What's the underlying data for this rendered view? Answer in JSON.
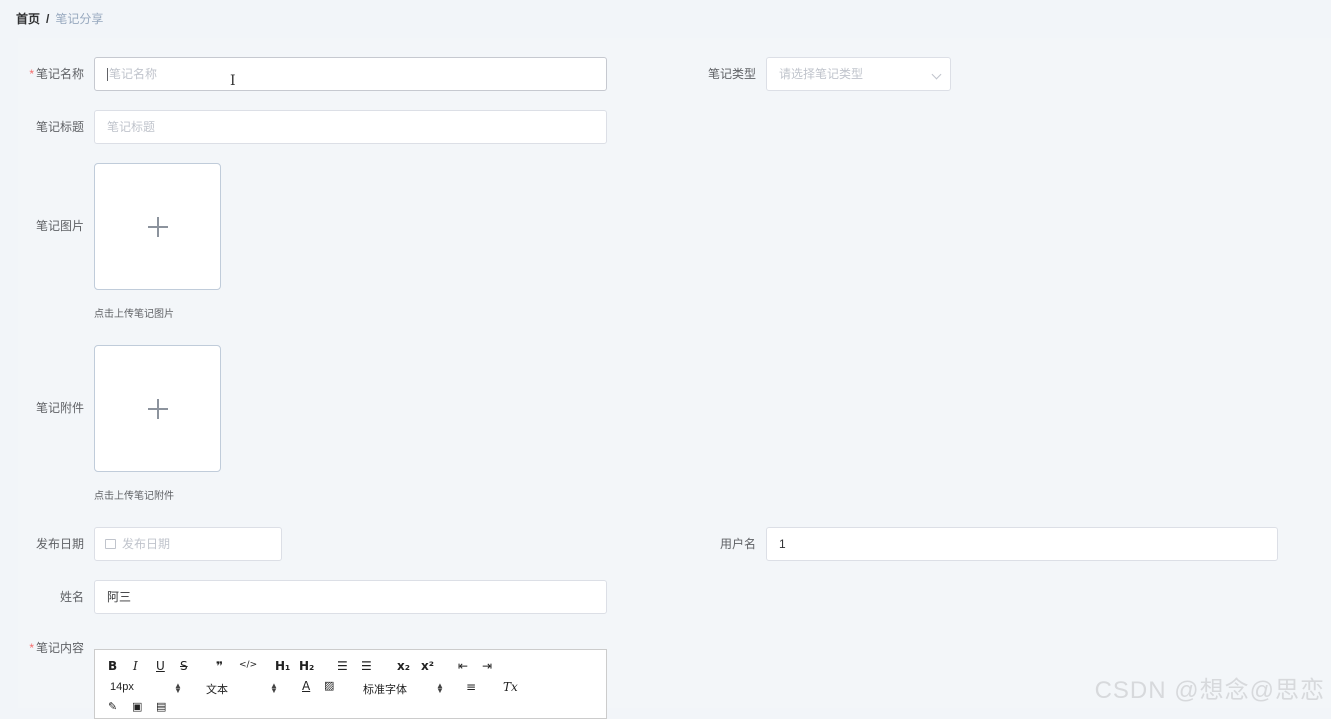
{
  "breadcrumb": {
    "home": "首页",
    "separator": "/",
    "current": "笔记分享"
  },
  "form": {
    "note_name": {
      "label": "笔记名称",
      "required": "*",
      "placeholder": "笔记名称"
    },
    "note_type": {
      "label": "笔记类型",
      "placeholder": "请选择笔记类型"
    },
    "note_title": {
      "label": "笔记标题",
      "placeholder": "笔记标题"
    },
    "note_image": {
      "label": "笔记图片",
      "tip": "点击上传笔记图片"
    },
    "note_attachment": {
      "label": "笔记附件",
      "tip": "点击上传笔记附件"
    },
    "publish_date": {
      "label": "发布日期",
      "placeholder": "发布日期"
    },
    "username": {
      "label": "用户名",
      "value": "1"
    },
    "real_name": {
      "label": "姓名",
      "value": "阿三"
    },
    "content": {
      "label": "笔记内容",
      "required": "*"
    }
  },
  "editor": {
    "toolbar": {
      "bold": "B",
      "italic": "I",
      "underline": "U",
      "strike": "S",
      "quote": "❞",
      "code": "</>",
      "h1": "H₁",
      "h2": "H₂",
      "ordered_list": "☰",
      "bullet_list": "☰",
      "subscript": "x₂",
      "superscript": "x²",
      "outdent": "⇤",
      "indent": "⇥",
      "font_size": "14px",
      "header": "文本",
      "font_family": "标准字体",
      "clear_format": "Tx"
    }
  },
  "watermark": "CSDN @想念@思恋",
  "cursor_glyph": "I"
}
